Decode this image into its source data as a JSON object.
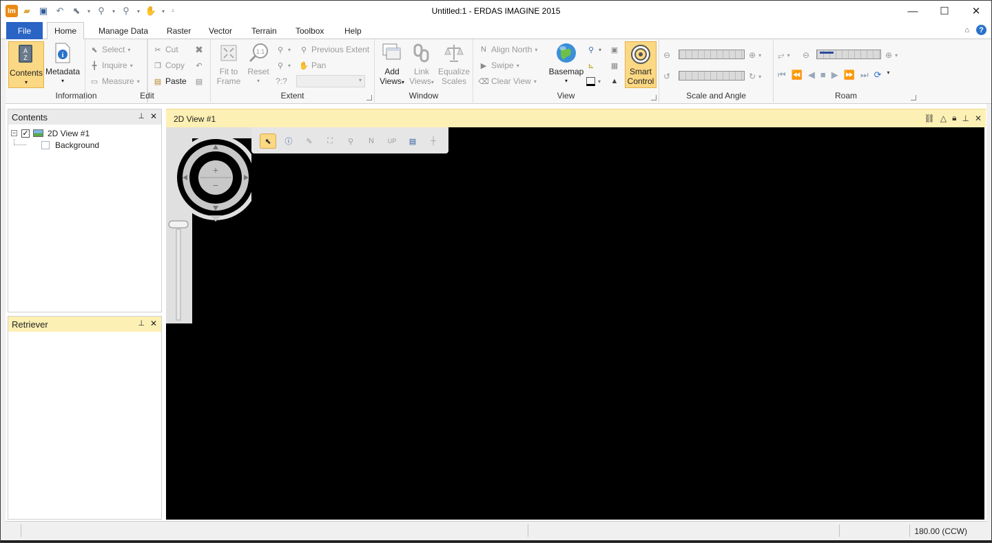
{
  "window": {
    "title": "Untitled:1 - ERDAS IMAGINE 2015",
    "app_icon_text": "Im",
    "minimize_label": "—",
    "maximize_label": "☐",
    "close_label": "✕"
  },
  "tabs": {
    "file": "File",
    "items": [
      "Home",
      "Manage Data",
      "Raster",
      "Vector",
      "Terrain",
      "Toolbox",
      "Help"
    ],
    "active": "Home"
  },
  "ribbon": {
    "information": {
      "label": "Information",
      "contents": "Contents",
      "metadata": "Metadata"
    },
    "edit": {
      "label": "Edit",
      "select": "Select",
      "inquire": "Inquire",
      "measure": "Measure",
      "cut": "Cut",
      "copy": "Copy",
      "paste": "Paste"
    },
    "extent": {
      "label": "Extent",
      "fit_to_frame_1": "Fit to",
      "fit_to_frame_2": "Frame",
      "reset": "Reset",
      "previous_extent": "Previous Extent",
      "pan": "Pan",
      "scale_prefix": "?:?"
    },
    "window": {
      "label": "Window",
      "add_views_1": "Add",
      "add_views_2": "Views",
      "link_views_1": "Link",
      "link_views_2": "Views",
      "equalize_1": "Equalize",
      "equalize_2": "Scales"
    },
    "view": {
      "label": "View",
      "align_north": "Align North",
      "swipe": "Swipe",
      "clear_view": "Clear View",
      "basemap": "Basemap",
      "smart_1": "Smart",
      "smart_2": "Control"
    },
    "scale_angle": {
      "label": "Scale and Angle"
    },
    "roam": {
      "label": "Roam"
    }
  },
  "contents_panel": {
    "title": "Contents",
    "items": [
      {
        "label": "2D View #1",
        "checked": true
      },
      {
        "label": "Background",
        "checked": false
      }
    ]
  },
  "retriever_panel": {
    "title": "Retriever"
  },
  "view": {
    "title": "2D View #1",
    "zoom_in": "+",
    "zoom_out": "−",
    "north_label": "N",
    "up_label": "UP"
  },
  "status": {
    "rotation": "180.00 (CCW)"
  }
}
